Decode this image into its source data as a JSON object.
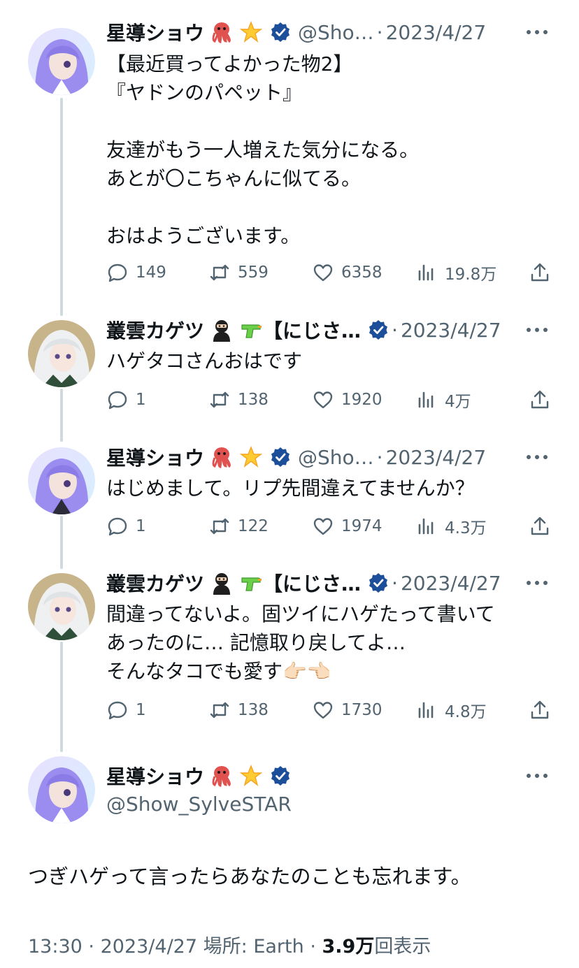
{
  "tweets": [
    {
      "name": "星導ショウ",
      "emojis": [
        "octopus-emoji",
        "glowing-star-emoji"
      ],
      "handle": "@Sho…",
      "date": "2023/4/27",
      "text": "【最近買ってよかった物2】\n『ヤドンのパペット』\n\n友達がもう一人増えた気分になる。\nあとが〇こちゃんに似てる。\n\nおはようございます。",
      "replies": "149",
      "retweets": "559",
      "likes": "6358",
      "views": "19.8万"
    },
    {
      "name": "叢雲カゲツ",
      "emojis": [
        "ninja-emoji",
        "water-pistol-emoji"
      ],
      "handle": "【にじさ…",
      "date": "2023/4/27",
      "text": "ハゲタコさんおはです",
      "replies": "1",
      "retweets": "138",
      "likes": "1920",
      "views": "4万"
    },
    {
      "name": "星導ショウ",
      "emojis": [
        "octopus-emoji",
        "glowing-star-emoji"
      ],
      "handle": "@Sho…",
      "date": "2023/4/27",
      "text": "はじめまして。リプ先間違えてませんか？",
      "replies": "1",
      "retweets": "122",
      "likes": "1974",
      "views": "4.3万"
    },
    {
      "name": "叢雲カゲツ",
      "emojis": [
        "ninja-emoji",
        "water-pistol-emoji"
      ],
      "handle": "【にじさ…",
      "date": "2023/4/27",
      "text": "間違ってないよ。固ツイにハゲたって書いて\nあったのに… 記憶取り戻してよ…\nそんなタコでも愛す👉🏻👈🏻",
      "replies": "1",
      "retweets": "138",
      "likes": "1730",
      "views": "4.8万"
    }
  ],
  "main_tweet": {
    "name": "星導ショウ",
    "handle": "@Show_SylveSTAR",
    "text": "つぎハゲって言ったらあなたのことも忘れます。",
    "time": "13:30",
    "date": "2023/4/27",
    "location": "場所: Earth",
    "views_count": "3.9万",
    "views_label": "回表示"
  },
  "separator": "·",
  "colors": {
    "text": "#0f1419",
    "muted": "#536471",
    "verified": "#1d4e9a",
    "thread_line": "#cfd9de"
  }
}
